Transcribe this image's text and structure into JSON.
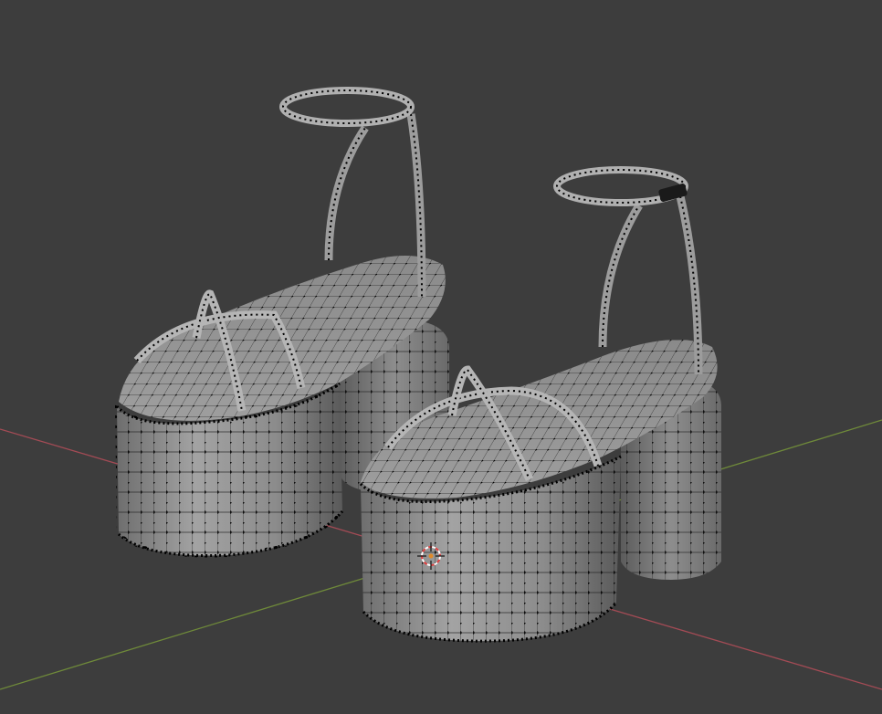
{
  "viewport": {
    "background_color": "#3d3d3d",
    "x_axis_color": "#a34b55",
    "y_axis_color": "#6f8a3a",
    "mesh_fill_color": "#8a8a8a",
    "wire_color": "#111111",
    "vertex_color": "#000000",
    "cursor_colors": [
      "#ffffff",
      "#e04040"
    ],
    "icons": [
      "3d-cursor-icon"
    ],
    "objects": [
      "sandal-left",
      "sandal-right"
    ]
  }
}
